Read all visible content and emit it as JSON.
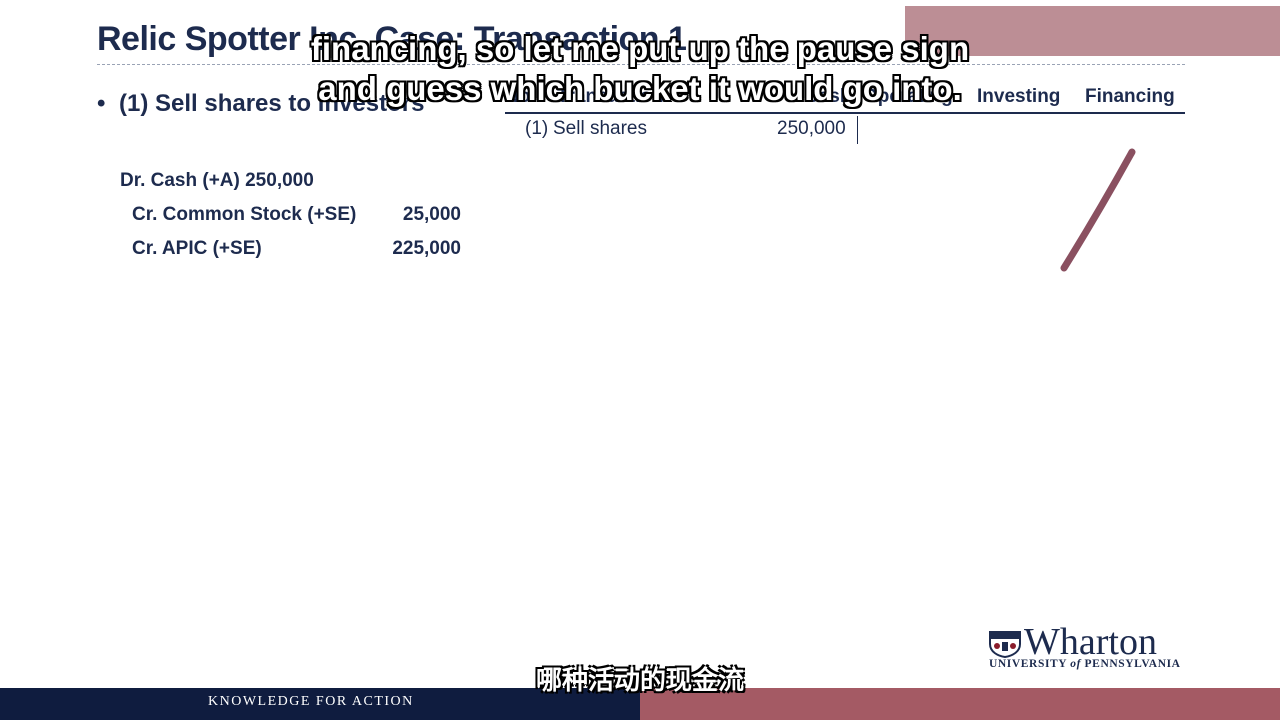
{
  "slide": {
    "title": "Relic Spotter Inc. Case: Transaction 1",
    "bullet_marker": "•",
    "bullet_text": "(1) Sell shares to investors"
  },
  "journal": {
    "lines": [
      {
        "label": "Dr. Cash (+A) 250,000",
        "amount": ""
      },
      {
        "label": "Cr. Common Stock (+SE)",
        "amount": "25,000"
      },
      {
        "label": "Cr. APIC (+SE)",
        "amount": "225,000"
      }
    ]
  },
  "table": {
    "headers": [
      "No.",
      "Transaction",
      "Cash",
      "Operating",
      "Investing",
      "Financing"
    ],
    "rows": [
      {
        "no": "(1)",
        "transaction": "Sell shares",
        "cash": "250,000",
        "operating": "",
        "investing": "",
        "financing": ""
      }
    ]
  },
  "subtitles": {
    "en_line1": "financing, so let me put up the pause sign",
    "en_line2": "and guess which bucket it would go into.",
    "cn": "哪种活动的现金流"
  },
  "footer": {
    "tagline": "KNOWLEDGE FOR ACTION"
  },
  "logo": {
    "name": "Wharton",
    "university_prefix": "UNIVERSITY",
    "of": "of",
    "university_suffix": "PENNSYLVANIA"
  },
  "colors": {
    "navy": "#1d2b4e",
    "footer_navy": "#0f1c3f",
    "footer_maroon": "#a45a64",
    "pen": "#8a5060"
  }
}
